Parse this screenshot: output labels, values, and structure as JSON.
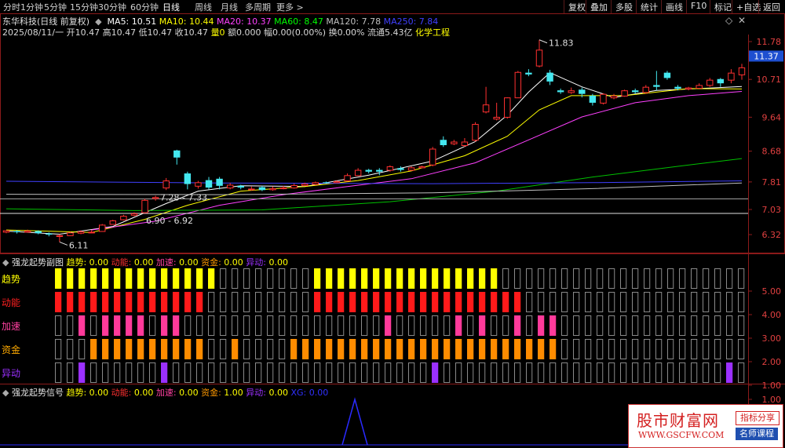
{
  "toolbar": {
    "periods": [
      "分时",
      "1分钟",
      "5分钟",
      "15分钟",
      "30分钟",
      "60分钟",
      "日线",
      "周线",
      "月线",
      "多周期",
      "更多 >"
    ],
    "active_period": "日线",
    "right_buttons": [
      "复权",
      "叠加",
      "多股",
      "统计",
      "画线",
      "F10",
      "标记",
      "+自选",
      "返回"
    ]
  },
  "quote": {
    "title": "东华科技(日线 前复权)",
    "ma_labels": [
      {
        "text": "MA5: 10.51",
        "color": "#ffffff"
      },
      {
        "text": "MA10: 10.44",
        "color": "#ffff00"
      },
      {
        "text": "MA20: 10.37",
        "color": "#ff40ff"
      },
      {
        "text": "MA60: 8.47",
        "color": "#00ff00"
      },
      {
        "text": "MA120: 7.78",
        "color": "#c0c0c0"
      },
      {
        "text": "MA250: 7.84",
        "color": "#4040ff"
      }
    ],
    "detail_prefix": "2025/08/11/一 开10.47 高10.47 低10.47 收10.47",
    "volume_text": "量0",
    "detail_rest": "额0.000 幅0.00(0.00%) 换0.00% 流通5.43亿",
    "industry": "化学工程"
  },
  "price_axis": {
    "ticks": [
      "11.78",
      "10.71",
      "9.64",
      "8.68",
      "7.81",
      "7.03",
      "6.32"
    ],
    "current_price": "11.37"
  },
  "chart_annotations": {
    "high": "11.83",
    "low": "6.11",
    "gap1": "7.28 - 7.33",
    "gap2": "6.90 - 6.92"
  },
  "candles": [
    [
      6.4,
      6.44,
      6.36,
      6.41
    ],
    [
      6.42,
      6.39,
      6.35,
      6.45
    ],
    [
      6.4,
      6.43,
      6.37,
      6.46
    ],
    [
      6.42,
      6.36,
      6.33,
      6.44
    ],
    [
      6.35,
      6.32,
      6.27,
      6.38
    ],
    [
      6.3,
      6.3,
      6.11,
      6.33
    ],
    [
      6.3,
      6.38,
      6.28,
      6.4
    ],
    [
      6.37,
      6.41,
      6.33,
      6.44
    ],
    [
      6.4,
      6.4,
      6.36,
      6.45
    ],
    [
      6.42,
      6.6,
      6.4,
      6.62
    ],
    [
      6.62,
      6.72,
      6.6,
      6.74
    ],
    [
      6.75,
      6.85,
      6.72,
      6.88
    ],
    [
      6.88,
      6.92,
      6.84,
      6.95
    ],
    [
      6.95,
      7.3,
      6.92,
      7.33
    ],
    [
      7.35,
      7.38,
      7.28,
      7.42
    ],
    [
      7.65,
      7.85,
      7.58,
      7.92
    ],
    [
      8.7,
      8.5,
      8.3,
      8.72
    ],
    [
      8.05,
      7.75,
      7.6,
      8.1
    ],
    [
      7.7,
      7.8,
      7.62,
      7.84
    ],
    [
      7.86,
      7.65,
      7.6,
      7.95
    ],
    [
      7.9,
      7.7,
      7.6,
      7.95
    ],
    [
      7.65,
      7.73,
      7.6,
      7.78
    ],
    [
      7.7,
      7.65,
      7.6,
      7.73
    ],
    [
      7.6,
      7.62,
      7.56,
      7.68
    ],
    [
      7.66,
      7.58,
      7.55,
      7.7
    ],
    [
      7.6,
      7.63,
      7.56,
      7.68
    ],
    [
      7.63,
      7.65,
      7.6,
      7.7
    ],
    [
      7.65,
      7.72,
      7.62,
      7.76
    ],
    [
      7.72,
      7.76,
      7.7,
      7.79
    ],
    [
      7.75,
      7.8,
      7.72,
      7.82
    ],
    [
      7.8,
      7.78,
      7.76,
      7.82
    ],
    [
      7.8,
      7.83,
      7.77,
      7.86
    ],
    [
      7.85,
      8.0,
      7.82,
      8.05
    ],
    [
      8.0,
      8.15,
      7.98,
      8.2
    ],
    [
      8.15,
      8.1,
      8.05,
      8.18
    ],
    [
      8.15,
      8.1,
      8.0,
      8.2
    ],
    [
      8.15,
      8.25,
      8.1,
      8.28
    ],
    [
      8.2,
      8.15,
      8.1,
      8.25
    ],
    [
      8.15,
      8.22,
      8.12,
      8.25
    ],
    [
      8.22,
      8.25,
      8.2,
      8.27
    ],
    [
      8.3,
      8.75,
      8.25,
      8.8
    ],
    [
      9.0,
      8.85,
      8.8,
      9.1
    ],
    [
      8.9,
      8.95,
      8.85,
      9.0
    ],
    [
      8.85,
      8.95,
      8.8,
      9.05
    ],
    [
      9.0,
      9.45,
      8.95,
      9.5
    ],
    [
      9.8,
      10.0,
      9.75,
      10.5
    ],
    [
      9.6,
      9.65,
      9.55,
      10.05
    ],
    [
      9.65,
      10.2,
      9.6,
      10.2
    ],
    [
      10.2,
      10.92,
      10.2,
      10.95
    ],
    [
      10.9,
      10.85,
      10.8,
      11.0
    ],
    [
      11.1,
      11.55,
      11.05,
      11.83
    ],
    [
      10.9,
      10.65,
      10.55,
      10.98
    ],
    [
      10.4,
      10.35,
      10.3,
      10.45
    ],
    [
      10.35,
      10.4,
      10.3,
      10.48
    ],
    [
      10.42,
      10.3,
      10.2,
      10.48
    ],
    [
      10.25,
      10.05,
      9.97,
      10.3
    ],
    [
      10.05,
      10.3,
      10.0,
      10.32
    ],
    [
      10.2,
      10.25,
      10.15,
      10.3
    ],
    [
      10.25,
      10.4,
      10.22,
      10.42
    ],
    [
      10.4,
      10.35,
      10.3,
      10.45
    ],
    [
      10.35,
      10.5,
      10.3,
      10.55
    ],
    [
      10.55,
      10.5,
      10.4,
      10.95
    ],
    [
      10.9,
      10.75,
      10.7,
      10.95
    ],
    [
      10.5,
      10.45,
      10.4,
      10.55
    ],
    [
      10.45,
      10.48,
      10.4,
      10.5
    ],
    [
      10.47,
      10.55,
      10.45,
      10.6
    ],
    [
      10.55,
      10.7,
      10.5,
      10.75
    ],
    [
      10.72,
      10.6,
      10.5,
      10.75
    ],
    [
      10.7,
      10.9,
      10.6,
      11.0
    ],
    [
      10.85,
      11.05,
      10.7,
      11.15
    ]
  ],
  "ma_lines": {
    "ma5": [
      [
        0,
        6.42
      ],
      [
        5,
        6.33
      ],
      [
        10,
        6.55
      ],
      [
        15,
        7.2
      ],
      [
        18,
        7.55
      ],
      [
        22,
        7.7
      ],
      [
        28,
        7.68
      ],
      [
        34,
        8.0
      ],
      [
        40,
        8.4
      ],
      [
        44,
        8.95
      ],
      [
        47,
        9.7
      ],
      [
        49,
        10.35
      ],
      [
        51,
        10.9
      ],
      [
        54,
        10.5
      ],
      [
        57,
        10.2
      ],
      [
        61,
        10.4
      ],
      [
        65,
        10.45
      ],
      [
        69,
        10.51
      ]
    ],
    "ma10": [
      [
        0,
        6.45
      ],
      [
        8,
        6.38
      ],
      [
        13,
        6.75
      ],
      [
        17,
        7.15
      ],
      [
        22,
        7.55
      ],
      [
        28,
        7.68
      ],
      [
        33,
        7.85
      ],
      [
        38,
        8.12
      ],
      [
        43,
        8.55
      ],
      [
        47,
        9.1
      ],
      [
        50,
        9.85
      ],
      [
        53,
        10.25
      ],
      [
        58,
        10.25
      ],
      [
        64,
        10.45
      ],
      [
        69,
        10.44
      ]
    ],
    "ma20": [
      [
        8,
        6.45
      ],
      [
        14,
        6.7
      ],
      [
        20,
        7.15
      ],
      [
        26,
        7.45
      ],
      [
        32,
        7.68
      ],
      [
        38,
        7.9
      ],
      [
        44,
        8.35
      ],
      [
        49,
        9.0
      ],
      [
        54,
        9.65
      ],
      [
        59,
        10.05
      ],
      [
        64,
        10.25
      ],
      [
        69,
        10.37
      ]
    ],
    "ma60": [
      [
        0,
        7.05
      ],
      [
        12,
        7.0
      ],
      [
        24,
        7.02
      ],
      [
        36,
        7.25
      ],
      [
        46,
        7.55
      ],
      [
        55,
        7.95
      ],
      [
        63,
        8.25
      ],
      [
        69,
        8.47
      ]
    ],
    "ma120": [
      [
        0,
        7.46
      ],
      [
        20,
        7.45
      ],
      [
        40,
        7.5
      ],
      [
        55,
        7.62
      ],
      [
        69,
        7.78
      ]
    ],
    "ma250": [
      [
        0,
        7.83
      ],
      [
        20,
        7.78
      ],
      [
        40,
        7.76
      ],
      [
        55,
        7.79
      ],
      [
        69,
        7.84
      ]
    ]
  },
  "sub1": {
    "title": "强龙起势副图",
    "values": [
      {
        "label": "趋势: 0.00",
        "color": "#ffff00"
      },
      {
        "label": "动能: 0.00",
        "color": "#ff3030"
      },
      {
        "label": "加速: 0.00",
        "color": "#ff40a0"
      },
      {
        "label": "资金: 0.00",
        "color": "#ff9900"
      },
      {
        "label": "异动: 0.00",
        "color": "#9b30ff"
      }
    ],
    "row_labels": [
      {
        "text": "趋势",
        "color": "#ffff00"
      },
      {
        "text": "动能",
        "color": "#ff2020"
      },
      {
        "text": "加速",
        "color": "#ff40a0"
      },
      {
        "text": "资金",
        "color": "#ffaa00"
      },
      {
        "text": "异动",
        "color": "#9b30ff"
      }
    ],
    "axis": [
      "5.00",
      "4.00",
      "3.00",
      "2.00",
      "1.00"
    ],
    "rows": {
      "trend": "0000001111111111111100000000111111111111111100000000000000000000000000",
      "energy": "0000001111111111111000000000111111111111111111000000000000000000000000",
      "accel": "0000000010111101100000000000000000100000101001011000000000000000000000",
      "fund": "0000000001111111111001000011111111111111111111111000000000000000000000",
      "abnorm": "0000000000000001000000000000000000000000000000000000000000000000000000"
    }
  },
  "sub2": {
    "title": "强龙起势信号",
    "values": [
      {
        "label": "趋势: 0.00",
        "color": "#ffff00"
      },
      {
        "label": "动能: 0.00",
        "color": "#ff3030"
      },
      {
        "label": "加速: 0.00",
        "color": "#ff40a0"
      },
      {
        "label": "资金: 1.00",
        "color": "#ff9900"
      },
      {
        "label": "异动: 0.00",
        "color": "#9b30ff"
      },
      {
        "label": "XG: 0.00",
        "color": "#3030ff"
      }
    ],
    "axis": [
      "1.00"
    ]
  },
  "watermark": {
    "site_cn": "股市财富网",
    "url": "WWW.GSCFW.COM",
    "tag1": "指标分享",
    "tag2": "名师课程"
  }
}
